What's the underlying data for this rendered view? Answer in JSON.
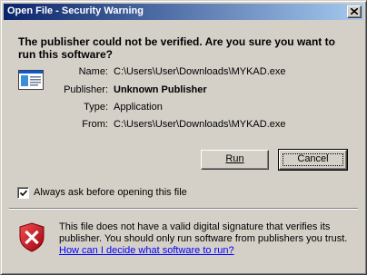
{
  "window": {
    "title": "Open File - Security Warning"
  },
  "headline": "The publisher could not be verified.  Are you sure you want to run this software?",
  "details": [
    {
      "label": "Name:",
      "value": "C:\\Users\\User\\Downloads\\MYKAD.exe",
      "bold": false
    },
    {
      "label": "Publisher:",
      "value": "Unknown Publisher",
      "bold": true
    },
    {
      "label": "Type:",
      "value": "Application",
      "bold": false
    },
    {
      "label": "From:",
      "value": "C:\\Users\\User\\Downloads\\MYKAD.exe",
      "bold": false
    }
  ],
  "buttons": {
    "run": "Run",
    "cancel": "Cancel"
  },
  "checkbox": {
    "label": "Always ask before opening this file",
    "checked": true
  },
  "warning": {
    "text": "This file does not have a valid digital signature that verifies its publisher.  You should only run software from publishers you trust.",
    "link": "How can I decide what software to run?"
  },
  "icons": {
    "close": "close-icon",
    "application": "application-icon",
    "checkmark": "checkmark-icon",
    "shield": "shield-warning-icon"
  },
  "colors": {
    "titlebar_start": "#0a246a",
    "titlebar_end": "#a6caf0",
    "dialog_bg": "#d4d0c8",
    "link": "#0000ff",
    "shield_red": "#c8102e"
  }
}
